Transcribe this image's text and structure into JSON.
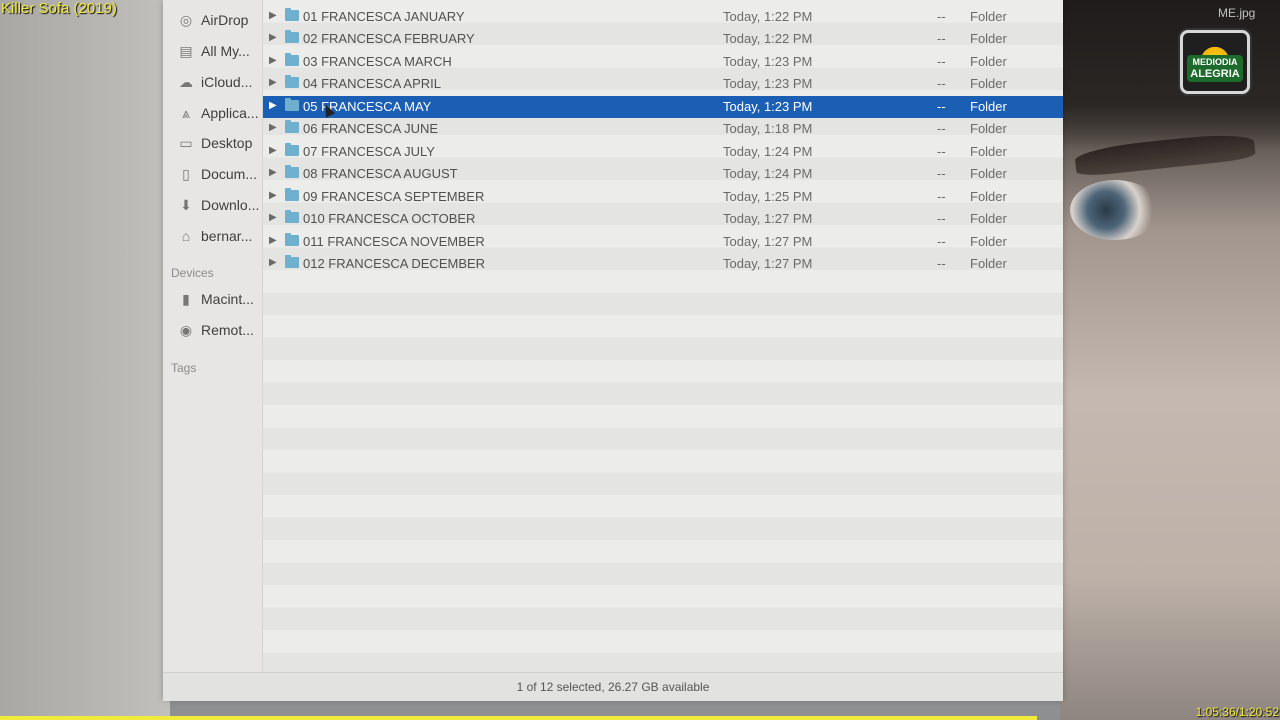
{
  "overlay": {
    "title": "Killer Sofa (2019)",
    "file_label": "ME.jpg",
    "timecode": "1:05:36/1:20:52",
    "logo_top": "MEDIODIA",
    "logo_main": "ALEGRIA",
    "progress_fraction": 0.81
  },
  "sidebar": {
    "favorites": [
      {
        "label": "AirDrop",
        "icon": "airdrop-icon"
      },
      {
        "label": "All My...",
        "icon": "all-my-files-icon"
      },
      {
        "label": "iCloud...",
        "icon": "cloud-icon"
      },
      {
        "label": "Applica...",
        "icon": "applications-icon"
      },
      {
        "label": "Desktop",
        "icon": "desktop-icon"
      },
      {
        "label": "Docum...",
        "icon": "document-icon"
      },
      {
        "label": "Downlo...",
        "icon": "download-icon"
      },
      {
        "label": "bernar...",
        "icon": "home-icon"
      }
    ],
    "devices_heading": "Devices",
    "devices": [
      {
        "label": "Macint...",
        "icon": "hard-drive-icon"
      },
      {
        "label": "Remot...",
        "icon": "remote-disc-icon"
      }
    ],
    "tags_heading": "Tags"
  },
  "files": [
    {
      "name": "01 FRANCESCA JANUARY",
      "date": "Today, 1:22 PM",
      "size": "--",
      "kind": "Folder"
    },
    {
      "name": "02 FRANCESCA FEBRUARY",
      "date": "Today, 1:22 PM",
      "size": "--",
      "kind": "Folder"
    },
    {
      "name": "03 FRANCESCA MARCH",
      "date": "Today, 1:23 PM",
      "size": "--",
      "kind": "Folder"
    },
    {
      "name": "04 FRANCESCA APRIL",
      "date": "Today, 1:23 PM",
      "size": "--",
      "kind": "Folder"
    },
    {
      "name": "05 FRANCESCA MAY",
      "date": "Today, 1:23 PM",
      "size": "--",
      "kind": "Folder"
    },
    {
      "name": "06 FRANCESCA JUNE",
      "date": "Today, 1:18 PM",
      "size": "--",
      "kind": "Folder"
    },
    {
      "name": "07 FRANCESCA JULY",
      "date": "Today, 1:24 PM",
      "size": "--",
      "kind": "Folder"
    },
    {
      "name": "08 FRANCESCA AUGUST",
      "date": "Today, 1:24 PM",
      "size": "--",
      "kind": "Folder"
    },
    {
      "name": "09 FRANCESCA SEPTEMBER",
      "date": "Today, 1:25 PM",
      "size": "--",
      "kind": "Folder"
    },
    {
      "name": "010 FRANCESCA OCTOBER",
      "date": "Today, 1:27 PM",
      "size": "--",
      "kind": "Folder"
    },
    {
      "name": "011 FRANCESCA NOVEMBER",
      "date": "Today, 1:27 PM",
      "size": "--",
      "kind": "Folder"
    },
    {
      "name": "012 FRANCESCA DECEMBER",
      "date": "Today, 1:27 PM",
      "size": "--",
      "kind": "Folder"
    }
  ],
  "selected_index": 4,
  "status": "1 of 12 selected, 26.27 GB available",
  "colors": {
    "selection": "#1a5fb4",
    "folder": "#6fb0cf",
    "overlay_text": "#f2ea3a"
  }
}
